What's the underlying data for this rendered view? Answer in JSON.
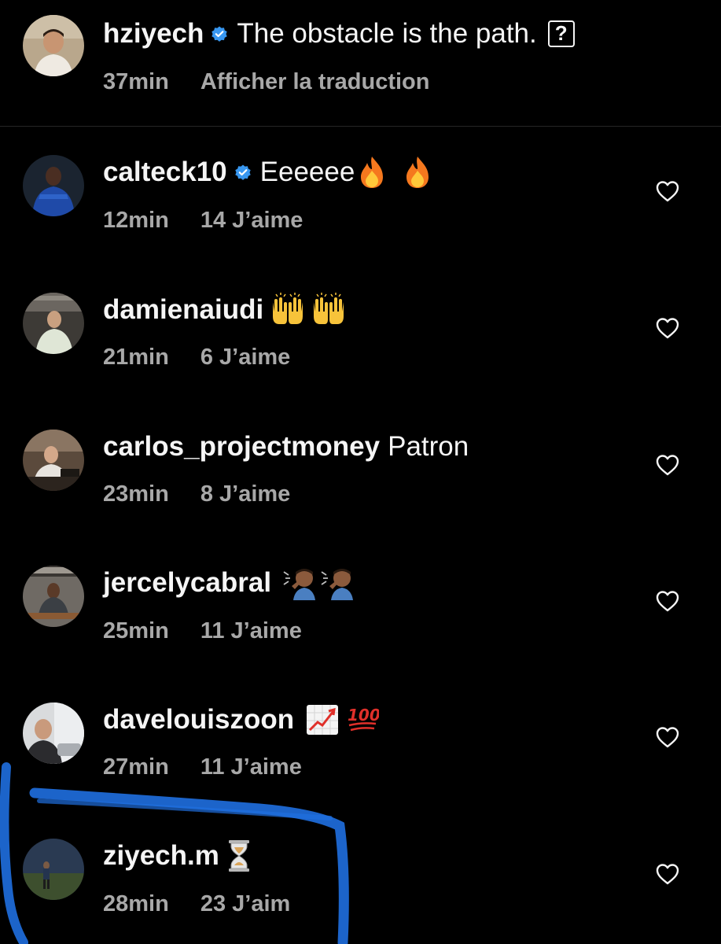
{
  "caption": {
    "username": "hziyech",
    "verified": true,
    "text": "The obstacle is the path.",
    "unknown_glyph": "?",
    "time": "37min",
    "translate_label": "Afficher la traduction"
  },
  "comments": [
    {
      "username": "calteck10",
      "verified": true,
      "text": "Eeeeee",
      "emojis": [
        "fire",
        "fire"
      ],
      "time": "12min",
      "likes": "14 J’aime"
    },
    {
      "username": "damienaiudi",
      "verified": false,
      "text": "",
      "emojis": [
        "raising-hands",
        "raising-hands"
      ],
      "time": "21min",
      "likes": "6 J’aime"
    },
    {
      "username": "carlos_projectmoney",
      "verified": false,
      "text": "Patron",
      "emojis": [],
      "time": "23min",
      "likes": "8 J’aime"
    },
    {
      "username": "jercelycabral",
      "verified": false,
      "text": "",
      "emojis": [
        "salute",
        "salute"
      ],
      "time": "25min",
      "likes": "11 J’aime"
    },
    {
      "username": "davelouiszoon",
      "verified": false,
      "text": "",
      "emojis": [
        "chart-increasing",
        "hundred-points"
      ],
      "time": "27min",
      "likes": "11 J’aime"
    },
    {
      "username": "ziyech.m",
      "verified": false,
      "text": "",
      "emojis": [
        "hourglass"
      ],
      "time": "28min",
      "likes": "23 J’aim"
    }
  ],
  "icons": {
    "like": "heart-outline-icon",
    "verified": "verified-badge-icon"
  },
  "colors": {
    "background": "#000000",
    "primary_text": "#f5f5f5",
    "secondary_text": "#a8a8a8",
    "verified_blue": "#3897f0",
    "annotation_blue": "#1f6fe0"
  }
}
